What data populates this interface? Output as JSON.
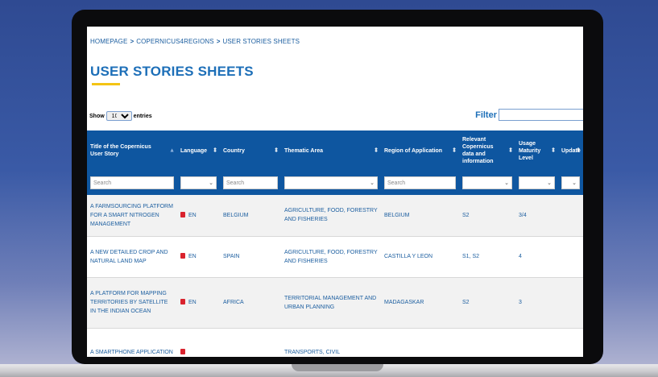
{
  "breadcrumb": [
    "HOMEPAGE",
    "COPERNICUS4REGIONS",
    "USER STORIES SHEETS"
  ],
  "title": "USER STORIES SHEETS",
  "show": {
    "label_before": "Show",
    "value": "10",
    "label_after": "entries"
  },
  "filter_label": "Filter",
  "columns": [
    "Title of the Copernicus User Story",
    "Language",
    "Country",
    "Thematic Area",
    "Region of Application",
    "Relevant Copernicus data and information",
    "Usage Maturity Level",
    "Update"
  ],
  "search_placeholder": "Search",
  "rows": [
    {
      "title": "A FARMSOURCING PLATFORM FOR A SMART NITROGEN MANAGEMENT",
      "language": "EN",
      "country": "BELGIUM",
      "thematic": "AGRICULTURE, FOOD, FORESTRY AND FISHERIES",
      "region": "BELGIUM",
      "data": "S2",
      "maturity": "3/4",
      "update": ""
    },
    {
      "title": "A NEW DETAILED CROP AND NATURAL LAND MAP",
      "language": "EN",
      "country": "SPAIN",
      "thematic": "AGRICULTURE, FOOD, FORESTRY AND FISHERIES",
      "region": "CASTILLA Y LEON",
      "data": "S1, S2",
      "maturity": "4",
      "update": ""
    },
    {
      "title": "A PLATFORM FOR MAPPING TERRITORIES BY SATELLITE IN THE INDIAN OCEAN",
      "language": "EN",
      "country": "AFRICA",
      "thematic": "TERRITORIAL MANAGEMENT AND URBAN PLANNING",
      "region": "MADAGASKAR",
      "data": "S2",
      "maturity": "3",
      "update": ""
    },
    {
      "title": "A SMARTPHONE APPLICATION",
      "language": "",
      "country": "",
      "thematic": "TRANSPORTS, CIVIL",
      "region": "",
      "data": "",
      "maturity": "",
      "update": ""
    }
  ],
  "colors": {
    "header_bg": "#0e56a0",
    "title": "#1d6fb8",
    "accent": "#f4c414",
    "link": "#1d5fa0",
    "pdf": "#d9232e"
  }
}
